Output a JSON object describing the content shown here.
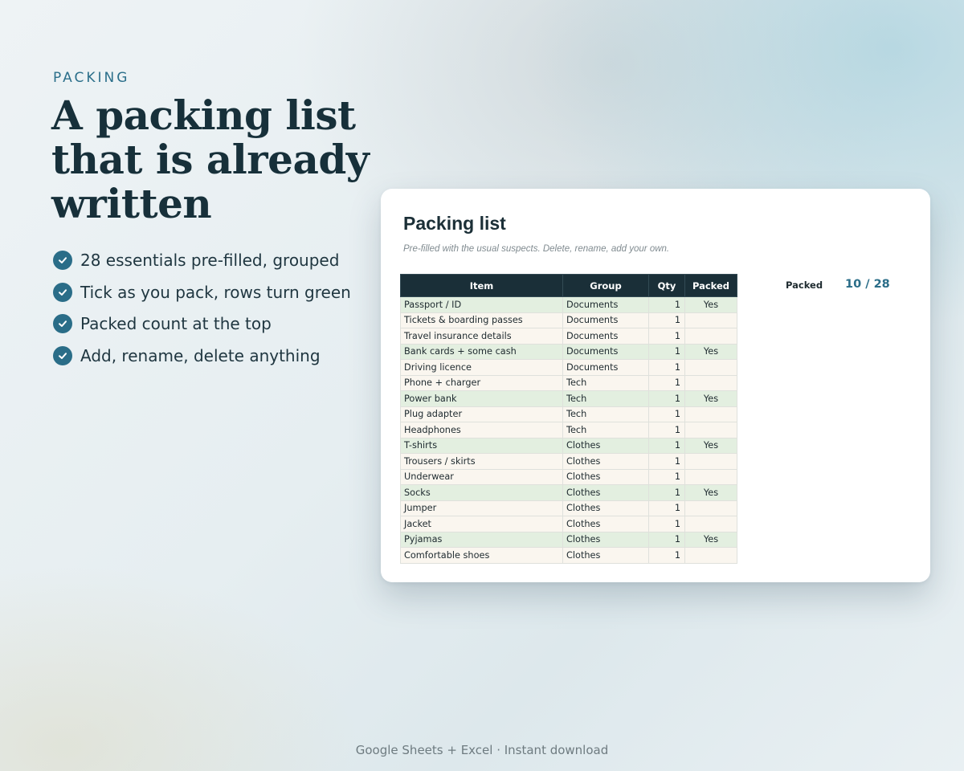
{
  "hero": {
    "eyebrow": "PACKING",
    "headline": "A packing list that is already written",
    "features": [
      "28 essentials pre-filled, grouped",
      "Tick as you pack, rows turn green",
      "Packed count at the top",
      "Add, rename, delete anything"
    ]
  },
  "card": {
    "title": "Packing list",
    "subtitle": "Pre-filled with the usual suspects. Delete, rename, add your own.",
    "columns": [
      "Item",
      "Group",
      "Qty",
      "Packed"
    ],
    "rows": [
      {
        "item": "Passport / ID",
        "group": "Documents",
        "qty": "1",
        "packed": "Yes"
      },
      {
        "item": "Tickets & boarding passes",
        "group": "Documents",
        "qty": "1",
        "packed": ""
      },
      {
        "item": "Travel insurance details",
        "group": "Documents",
        "qty": "1",
        "packed": ""
      },
      {
        "item": "Bank cards + some cash",
        "group": "Documents",
        "qty": "1",
        "packed": "Yes"
      },
      {
        "item": "Driving licence",
        "group": "Documents",
        "qty": "1",
        "packed": ""
      },
      {
        "item": "Phone + charger",
        "group": "Tech",
        "qty": "1",
        "packed": ""
      },
      {
        "item": "Power bank",
        "group": "Tech",
        "qty": "1",
        "packed": "Yes"
      },
      {
        "item": "Plug adapter",
        "group": "Tech",
        "qty": "1",
        "packed": ""
      },
      {
        "item": "Headphones",
        "group": "Tech",
        "qty": "1",
        "packed": ""
      },
      {
        "item": "T-shirts",
        "group": "Clothes",
        "qty": "1",
        "packed": "Yes"
      },
      {
        "item": "Trousers / skirts",
        "group": "Clothes",
        "qty": "1",
        "packed": ""
      },
      {
        "item": "Underwear",
        "group": "Clothes",
        "qty": "1",
        "packed": ""
      },
      {
        "item": "Socks",
        "group": "Clothes",
        "qty": "1",
        "packed": "Yes"
      },
      {
        "item": "Jumper",
        "group": "Clothes",
        "qty": "1",
        "packed": ""
      },
      {
        "item": "Jacket",
        "group": "Clothes",
        "qty": "1",
        "packed": ""
      },
      {
        "item": "Pyjamas",
        "group": "Clothes",
        "qty": "1",
        "packed": "Yes"
      },
      {
        "item": "Comfortable shoes",
        "group": "Clothes",
        "qty": "1",
        "packed": ""
      }
    ],
    "summary": {
      "label": "Packed",
      "value": "10 / 28"
    }
  },
  "footer": "Google Sheets + Excel  ·  Instant download",
  "colors": {
    "accent": "#2a6d88",
    "header_bg": "#1a2f38",
    "packed_row": "#e3efe0",
    "unpacked_row": "#faf6ef"
  },
  "icons": {
    "feature_bullet": "check-circle-icon"
  }
}
